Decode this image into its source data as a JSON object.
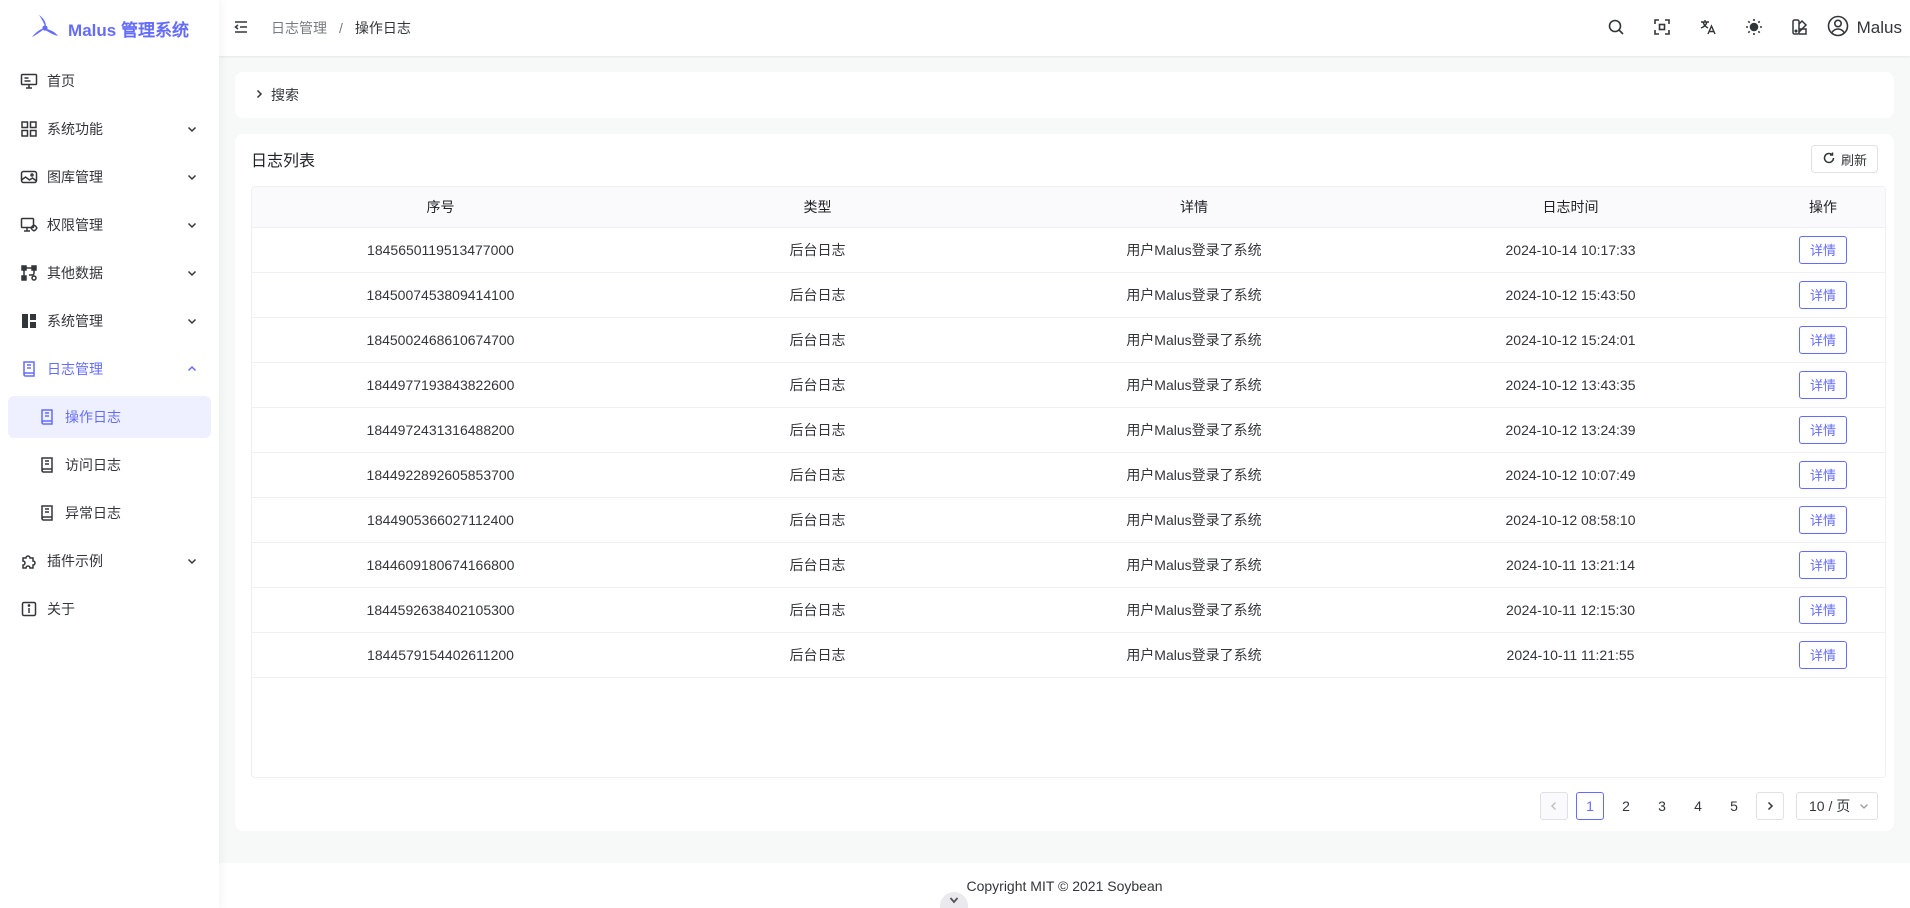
{
  "app": {
    "title": "Malus 管理系统"
  },
  "sidebar": {
    "items": [
      {
        "label": "首页",
        "icon": "monitor-icon"
      },
      {
        "label": "系统功能",
        "icon": "grid-icon",
        "expandable": true
      },
      {
        "label": "图库管理",
        "icon": "gallery-icon",
        "expandable": true
      },
      {
        "label": "权限管理",
        "icon": "permission-icon",
        "expandable": true
      },
      {
        "label": "其他数据",
        "icon": "data-icon",
        "expandable": true
      },
      {
        "label": "系统管理",
        "icon": "dashboard-icon",
        "expandable": true
      },
      {
        "label": "日志管理",
        "icon": "log-book-icon",
        "expandable": true,
        "open": true
      },
      {
        "label": "操作日志",
        "icon": "log-book-icon",
        "sub": true,
        "active": true
      },
      {
        "label": "访问日志",
        "icon": "log-book-icon",
        "sub": true
      },
      {
        "label": "异常日志",
        "icon": "log-book-icon",
        "sub": true
      },
      {
        "label": "插件示例",
        "icon": "plugin-icon",
        "expandable": true
      },
      {
        "label": "关于",
        "icon": "info-icon"
      }
    ]
  },
  "header": {
    "breadcrumb": [
      "日志管理",
      "操作日志"
    ],
    "user": "Malus"
  },
  "search": {
    "label": "搜索"
  },
  "list": {
    "title": "日志列表",
    "refresh_label": "刷新",
    "columns": [
      "序号",
      "类型",
      "详情",
      "日志时间",
      "操作"
    ],
    "action_label": "详情",
    "rows": [
      {
        "id": "1845650119513477000",
        "type": "后台日志",
        "detail": "用户Malus登录了系统",
        "time": "2024-10-14 10:17:33"
      },
      {
        "id": "1845007453809414100",
        "type": "后台日志",
        "detail": "用户Malus登录了系统",
        "time": "2024-10-12 15:43:50"
      },
      {
        "id": "1845002468610674700",
        "type": "后台日志",
        "detail": "用户Malus登录了系统",
        "time": "2024-10-12 15:24:01"
      },
      {
        "id": "1844977193843822600",
        "type": "后台日志",
        "detail": "用户Malus登录了系统",
        "time": "2024-10-12 13:43:35"
      },
      {
        "id": "1844972431316488200",
        "type": "后台日志",
        "detail": "用户Malus登录了系统",
        "time": "2024-10-12 13:24:39"
      },
      {
        "id": "1844922892605853700",
        "type": "后台日志",
        "detail": "用户Malus登录了系统",
        "time": "2024-10-12 10:07:49"
      },
      {
        "id": "1844905366027112400",
        "type": "后台日志",
        "detail": "用户Malus登录了系统",
        "time": "2024-10-12 08:58:10"
      },
      {
        "id": "1844609180674166800",
        "type": "后台日志",
        "detail": "用户Malus登录了系统",
        "time": "2024-10-11 13:21:14"
      },
      {
        "id": "1844592638402105300",
        "type": "后台日志",
        "detail": "用户Malus登录了系统",
        "time": "2024-10-11 12:15:30"
      },
      {
        "id": "1844579154402611200",
        "type": "后台日志",
        "detail": "用户Malus登录了系统",
        "time": "2024-10-11 11:21:55"
      }
    ]
  },
  "pagination": {
    "pages": [
      "1",
      "2",
      "3",
      "4",
      "5"
    ],
    "current": "1",
    "page_size": "10 / 页"
  },
  "footer": {
    "text": "Copyright MIT © 2021 Soybean"
  },
  "colors": {
    "primary": "#646cff",
    "active_bg": "#eff0ff"
  }
}
